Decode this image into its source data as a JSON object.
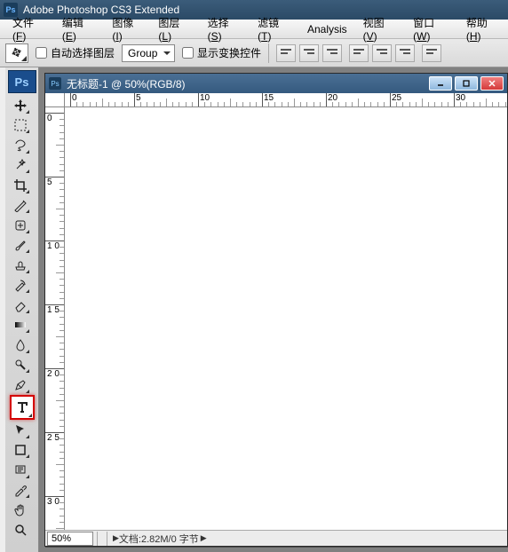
{
  "app": {
    "title": "Adobe Photoshop CS3 Extended",
    "badge": "Ps"
  },
  "menu": [
    {
      "label": "文件",
      "mn": "F"
    },
    {
      "label": "编辑",
      "mn": "E"
    },
    {
      "label": "图像",
      "mn": "I"
    },
    {
      "label": "图层",
      "mn": "L"
    },
    {
      "label": "选择",
      "mn": "S"
    },
    {
      "label": "滤镜",
      "mn": "T"
    },
    {
      "label": "Analysis",
      "mn": ""
    },
    {
      "label": "视图",
      "mn": "V"
    },
    {
      "label": "窗口",
      "mn": "W"
    },
    {
      "label": "帮助",
      "mn": "H"
    }
  ],
  "options": {
    "auto_select_label": "自动选择图层",
    "group_value": "Group",
    "show_transform_label": "显示变换控件"
  },
  "tools": [
    {
      "name": "move",
      "fly": true
    },
    {
      "name": "marquee",
      "fly": true
    },
    {
      "name": "lasso",
      "fly": true
    },
    {
      "name": "magic-wand",
      "fly": true
    },
    {
      "name": "crop",
      "fly": true
    },
    {
      "name": "slice",
      "fly": true
    },
    {
      "name": "healing-brush",
      "fly": true
    },
    {
      "name": "brush",
      "fly": true
    },
    {
      "name": "clone-stamp",
      "fly": true
    },
    {
      "name": "history-brush",
      "fly": true
    },
    {
      "name": "eraser",
      "fly": true
    },
    {
      "name": "gradient",
      "fly": true
    },
    {
      "name": "blur",
      "fly": true
    },
    {
      "name": "dodge",
      "fly": true
    },
    {
      "name": "pen",
      "fly": true
    },
    {
      "name": "type",
      "fly": true,
      "selected": true
    },
    {
      "name": "path-selection",
      "fly": true
    },
    {
      "name": "shape",
      "fly": true
    },
    {
      "name": "notes",
      "fly": true
    },
    {
      "name": "eyedropper",
      "fly": true
    },
    {
      "name": "hand",
      "fly": false
    },
    {
      "name": "zoom",
      "fly": false
    }
  ],
  "doc": {
    "title": "无标题-1 @ 50%(RGB/8)",
    "zoom": "50%",
    "status_prefix": "文档:",
    "status_value": "2.82M/0 字节",
    "ruler_h": [
      "0",
      "5",
      "10",
      "15",
      "20",
      "25",
      "30"
    ],
    "ruler_v": [
      "0",
      "5",
      "1 0",
      "1 5",
      "2 0",
      "2 5",
      "3 0"
    ]
  }
}
